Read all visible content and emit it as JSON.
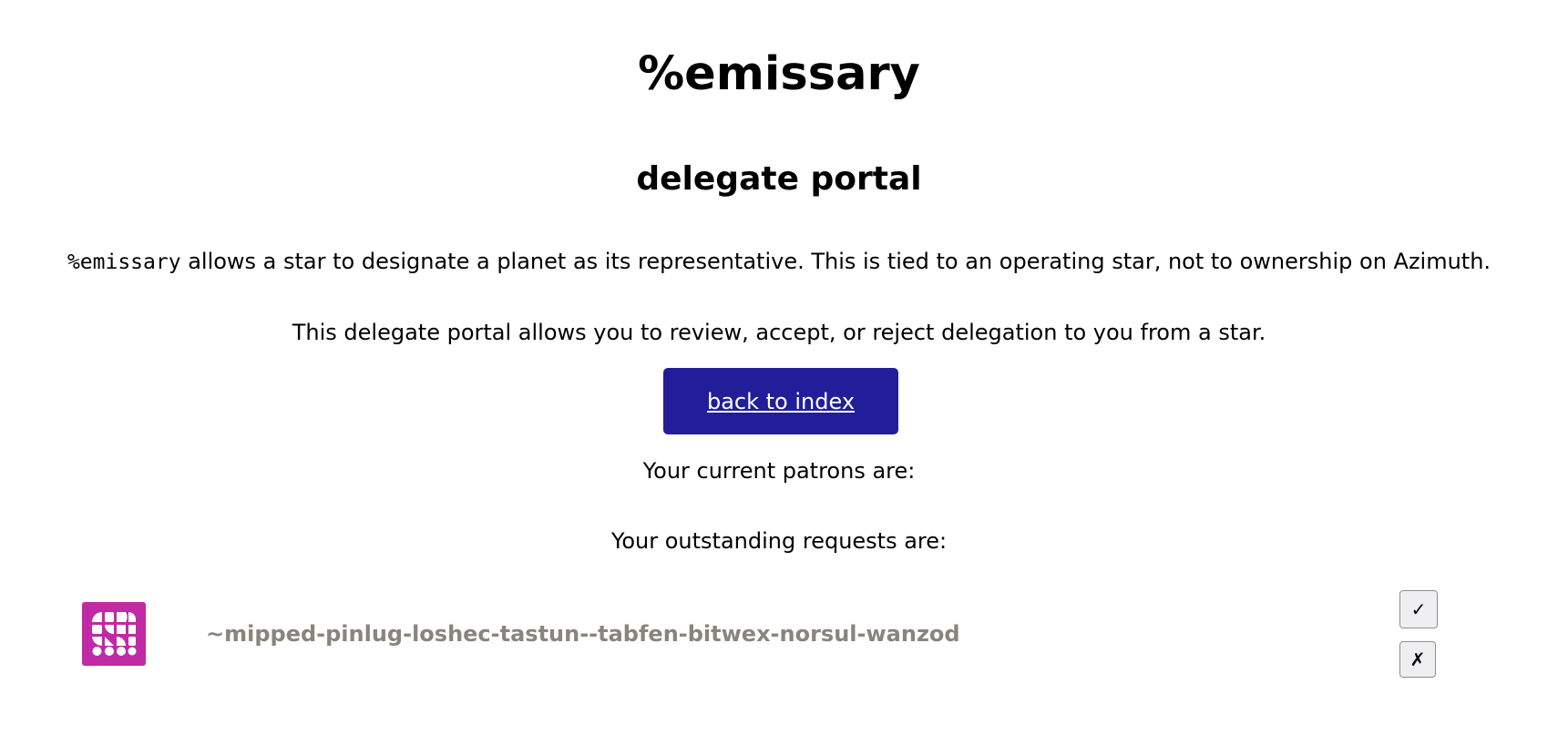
{
  "header": {
    "app_title": "%emissary",
    "subtitle": "delegate portal"
  },
  "intro": {
    "code_name": "%emissary",
    "description_rest": " allows a star to designate a planet as its representative. This is tied to an operating star, not to ownership on Azimuth.",
    "portal_description": "This delegate portal allows you to review, accept, or reject delegation to you from a star."
  },
  "nav": {
    "back_label": "back to index"
  },
  "patrons": {
    "heading": "Your current patrons are:",
    "items": []
  },
  "requests": {
    "heading": "Your outstanding requests are:",
    "items": [
      {
        "ship": "~mipped-pinlug-loshec-tastun--tabfen-bitwex-norsul-wanzod",
        "sigil_color": "#c02aa4",
        "accept_label": "✓",
        "reject_label": "✗"
      }
    ]
  },
  "colors": {
    "button_bg": "#221e99",
    "ship_text": "#8a857c",
    "sigil_bg": "#c02aa4"
  }
}
